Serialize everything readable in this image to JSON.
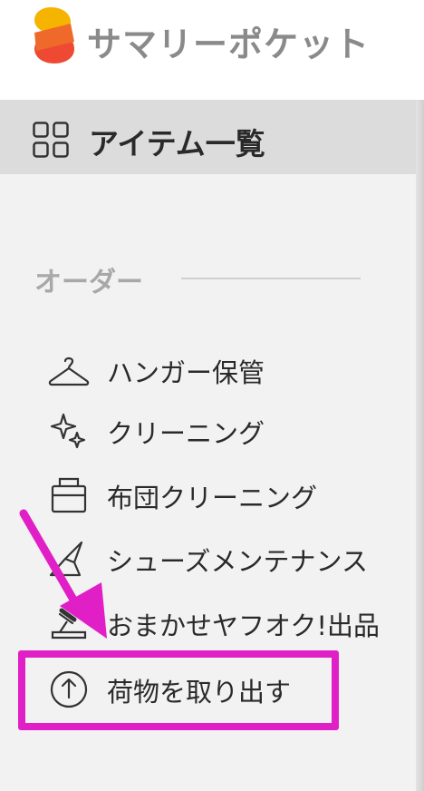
{
  "header": {
    "app_title": "サマリーポケット"
  },
  "nav": {
    "items_list_label": "アイテム一覧"
  },
  "order_section": {
    "heading": "オーダー",
    "items": [
      {
        "label": "ハンガー保管",
        "icon": "hanger-icon"
      },
      {
        "label": "クリーニング",
        "icon": "sparkle-icon"
      },
      {
        "label": "布団クリーニング",
        "icon": "futon-icon"
      },
      {
        "label": "シューズメンテナンス",
        "icon": "shoe-icon"
      },
      {
        "label": "おまかせヤフオク!出品",
        "icon": "auction-icon"
      },
      {
        "label": "荷物を取り出す",
        "icon": "upload-circle-icon"
      }
    ]
  },
  "colors": {
    "logo_yellow": "#f5b400",
    "logo_red": "#ee4a33",
    "annotation_magenta": "#e020c6",
    "active_row_bg": "#dcdcdc",
    "sidebar_bg": "#f2f2f2"
  }
}
